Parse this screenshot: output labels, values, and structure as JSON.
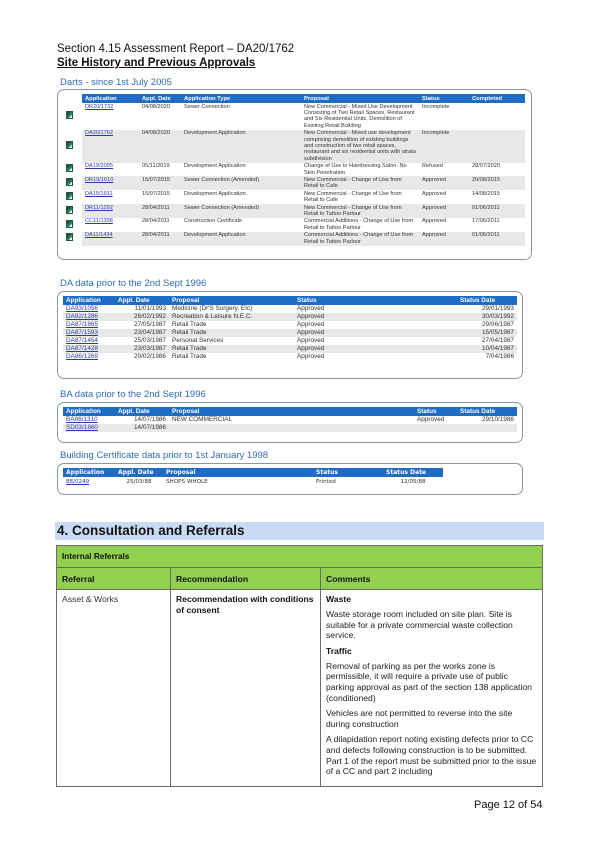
{
  "header": {
    "title": "Section 4.15 Assessment Report – DA20/1762",
    "subtitle": "Site History and Previous Approvals"
  },
  "darts": {
    "caption": "Darts - since 1st July 2005",
    "columns": [
      "Application",
      "Appl. Date",
      "Application Type",
      "Proposal",
      "Status",
      "Completed"
    ],
    "rows": [
      {
        "application": "DR20/1732",
        "date": "04/08/2020",
        "type": "Sewer Connection",
        "proposal": "New Commercial - Mixed Use Development Consisting of Two Retail Spaces, Restaurant and Six Residential Units. Demolition of Existing Retail Building",
        "status": "Incomplete",
        "completed": ""
      },
      {
        "application": "DA20/1762",
        "date": "04/08/2020",
        "type": "Development Application",
        "proposal": "New Commercial - Mixed use development comprising demolition of existing buildings and construction of two retail spaces, restaurant and six residential units with strata subdivision",
        "status": "Incomplete",
        "completed": ""
      },
      {
        "application": "DA19/2095",
        "date": "05/11/2019",
        "type": "Development Application",
        "proposal": "Change of Use to Hairdressing Salon. No Skin Penetration",
        "status": "Refused",
        "completed": "28/07/2020"
      },
      {
        "application": "DR15/1610",
        "date": "15/07/2015",
        "type": "Sewer Connection (Amended)",
        "proposal": "New Commercial - Change of Use from Retail to Cafe",
        "status": "Approved",
        "completed": "20/08/2015"
      },
      {
        "application": "DA15/1911",
        "date": "15/07/2015",
        "type": "Development Application",
        "proposal": "New Commercial - Change of Use from Retail to Cafe",
        "status": "Approved",
        "completed": "14/08/2015"
      },
      {
        "application": "DR11/1292",
        "date": "28/04/2011",
        "type": "Sewer Connection (Amended)",
        "proposal": "New Commercial - Change of Use from Retail to Tattoo Parlour",
        "status": "Approved",
        "completed": "01/06/2011"
      },
      {
        "application": "CC11/1398",
        "date": "28/04/2011",
        "type": "Construction Certificate",
        "proposal": "Commercial Additions - Change of Use from Retail to Tattoo Parlour",
        "status": "Approved",
        "completed": "17/06/2011"
      },
      {
        "application": "DA11/1434",
        "date": "28/04/2011",
        "type": "Development Application",
        "proposal": "Commercial Additions - Change of Use from Retail to Tattoo Parlour",
        "status": "Approved",
        "completed": "01/06/2011"
      }
    ]
  },
  "da_pre1996": {
    "caption": "DA data prior to the 2nd Sept 1996",
    "columns": [
      "Application",
      "Appl. Date",
      "Proposal",
      "Status",
      "Status Date"
    ],
    "rows": [
      {
        "application": "DA93/1056",
        "date": "11/01/1993",
        "proposal": "Medicine (Dr'S Surgery, Etc)",
        "status": "Approved",
        "status_date": "29/01/1993"
      },
      {
        "application": "DA92/1286",
        "date": "26/02/1992",
        "proposal": "Recreation & Leisure N.E.C.",
        "status": "Approved",
        "status_date": "30/03/1992"
      },
      {
        "application": "DA87/1865",
        "date": "27/05/1987",
        "proposal": "Retail Trade",
        "status": "Approved",
        "status_date": "29/06/1987"
      },
      {
        "application": "DA87/1593",
        "date": "23/04/1987",
        "proposal": "Retail Trade",
        "status": "Approved",
        "status_date": "15/05/1987"
      },
      {
        "application": "DA87/1454",
        "date": "25/03/1987",
        "proposal": "Personal Services",
        "status": "Approved",
        "status_date": "27/04/1987"
      },
      {
        "application": "DA87/1428",
        "date": "23/03/1987",
        "proposal": "Retail Trade",
        "status": "Approved",
        "status_date": "10/04/1987"
      },
      {
        "application": "DA86/1269",
        "date": "20/02/1986",
        "proposal": "Retail Trade",
        "status": "Approved",
        "status_date": "7/04/1986"
      }
    ]
  },
  "ba_pre1996": {
    "caption": "BA data prior to the 2nd Sept 1996",
    "columns": [
      "Application",
      "Appl. Date",
      "Proposal",
      "Status",
      "Status Date"
    ],
    "rows": [
      {
        "application": "BA86/1310",
        "date": "14/07/1986",
        "proposal": "NEW COMMERCIAL",
        "status": "Approved",
        "status_date": "29/10/1986"
      },
      {
        "application": "SD03/1860",
        "date": "14/07/1986",
        "proposal": "",
        "status": "",
        "status_date": ""
      }
    ]
  },
  "bc_pre1998": {
    "caption": "Building Certificate data prior to 1st January 1998",
    "columns": [
      "Application",
      "Appl. Date",
      "Proposal",
      "Status",
      "Status Date"
    ],
    "rows": [
      {
        "application": "88/0249",
        "date": "25/03/88",
        "proposal": "SHOPS WHOLE",
        "status": "Printed",
        "status_date": "12/05/88"
      }
    ]
  },
  "consultation": {
    "heading": "4.  Consultation and Referrals",
    "table_title": "Internal Referrals",
    "columns": [
      "Referral",
      "Recommendation",
      "Comments"
    ],
    "row": {
      "referral": "Asset & Works",
      "recommendation": "Recommendation with conditions of consent",
      "comments": [
        {
          "heading": "Waste",
          "paragraphs": [
            "Waste storage room included on site plan. Site is suitable for a private commercial waste collection service."
          ]
        },
        {
          "heading": "Traffic",
          "paragraphs": [
            "Removal of parking as per the works zone is permissible, it will require a private use of public parking approval as part of the section 138 application (conditioned)",
            " Vehicles are not permitted to reverse into the site during construction",
            " A dilapidation report noting existing defects prior to CC and defects following construction is to be submitted. Part 1 of the report must be submitted prior to the issue of a CC and part 2 including"
          ]
        }
      ]
    }
  },
  "footer": {
    "page": "Page 12 of 54"
  },
  "colors": {
    "table_header": "#1f6cc4",
    "caption": "#2f6cb0",
    "referral_green": "#92d050",
    "section_band": "#c9daf4",
    "row_alt": "#e8e9e6",
    "link": "#2a3aa8"
  }
}
